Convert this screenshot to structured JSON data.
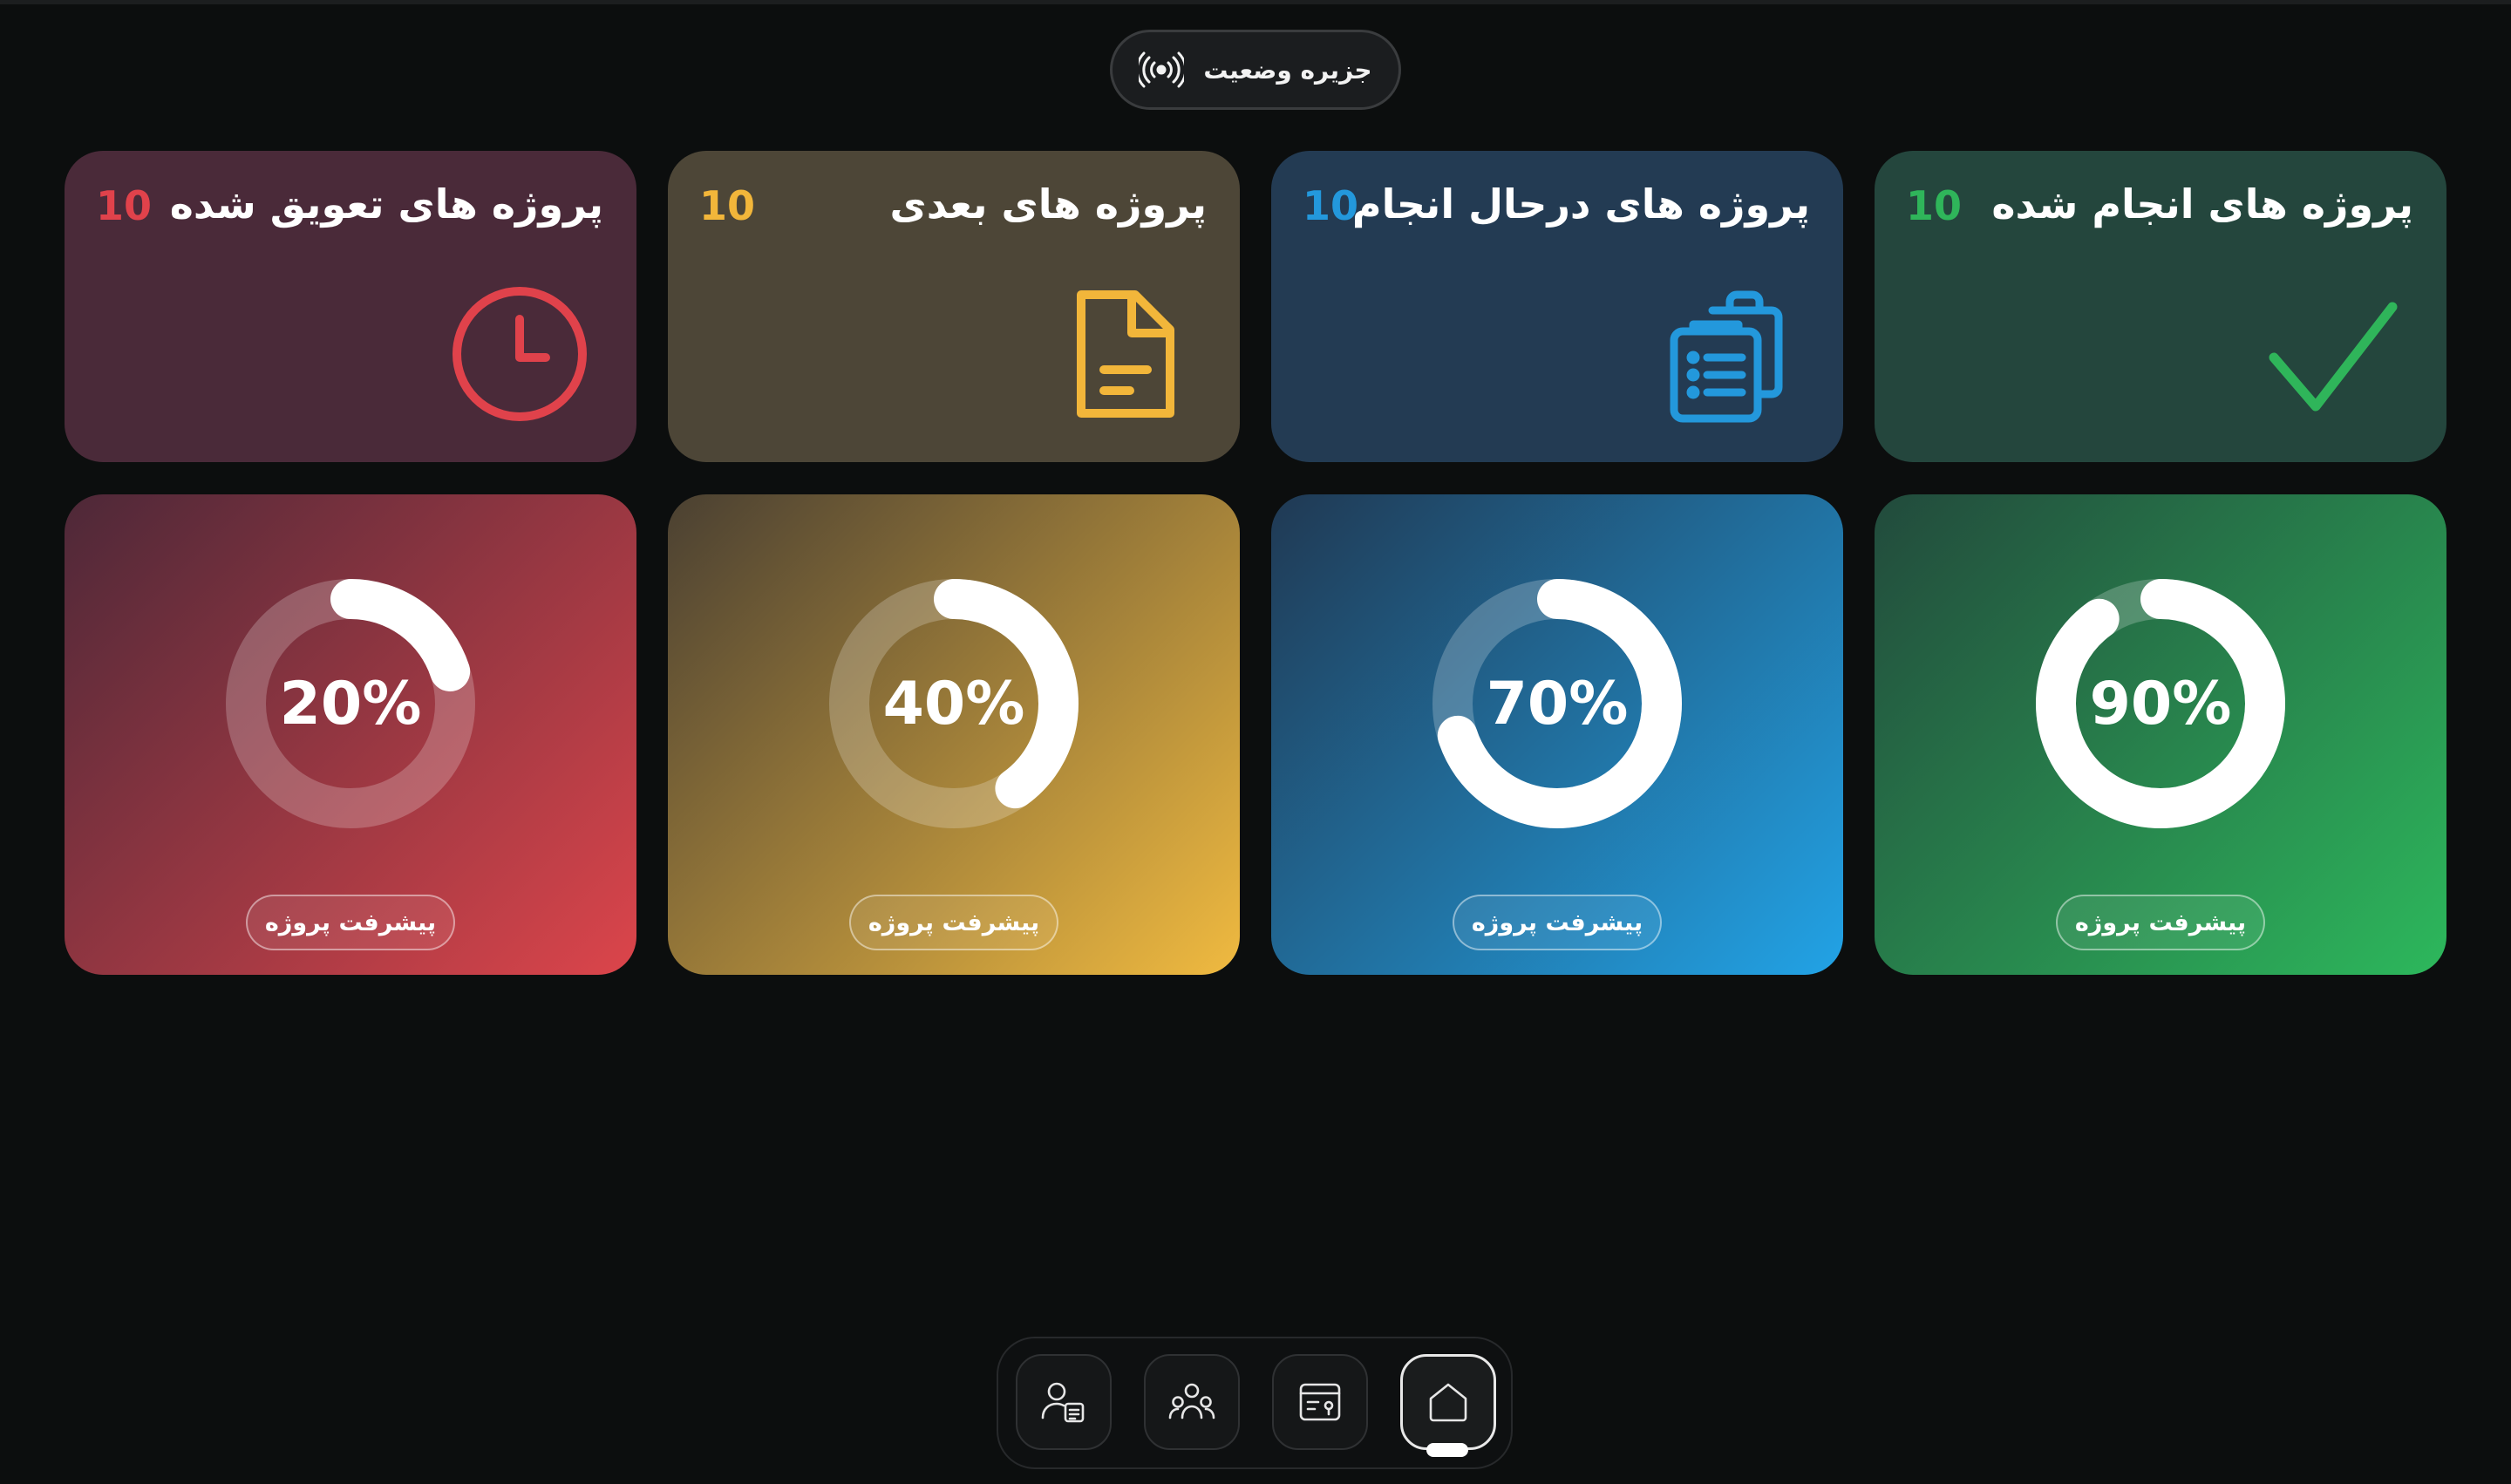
{
  "status_island": {
    "label": "جزیره وضعیت",
    "icon": "broadcast-icon"
  },
  "summary_cards": [
    {
      "title": "پروژه های تعویق شده",
      "count": "10",
      "accent": "#e0424b",
      "bg": "#4a2a39",
      "icon": "clock-icon"
    },
    {
      "title": "پروژه های بعدی",
      "count": "10",
      "accent": "#f2b63a",
      "bg": "#4d4637",
      "icon": "document-icon"
    },
    {
      "title": "پروژه های درحال انجام",
      "count": "10",
      "accent": "#2398dc",
      "bg": "#233b53",
      "icon": "clipboard-list-icon"
    },
    {
      "title": "پروژه های انجام شده",
      "count": "10",
      "accent": "#2fb55a",
      "bg": "#24463d",
      "icon": "checkmark-icon"
    }
  ],
  "progress_cards": [
    {
      "percent": 20,
      "percent_label": "20%",
      "chip_label": "پیشرفت پروژه",
      "gradient": [
        "#4d2838",
        "#dc454b"
      ]
    },
    {
      "percent": 40,
      "percent_label": "40%",
      "chip_label": "پیشرفت پروژه",
      "gradient": [
        "#4a4032",
        "#f0ba40"
      ]
    },
    {
      "percent": 70,
      "percent_label": "70%",
      "chip_label": "پیشرفت پروژه",
      "gradient": [
        "#203953",
        "#22a3e6"
      ]
    },
    {
      "percent": 90,
      "percent_label": "90%",
      "chip_label": "پیشرفت پروژه",
      "gradient": [
        "#224a3c",
        "#2db85c"
      ]
    }
  ],
  "dock": {
    "items": [
      {
        "icon": "user-report-icon",
        "active": false
      },
      {
        "icon": "team-icon",
        "active": false
      },
      {
        "icon": "board-icon",
        "active": false
      },
      {
        "icon": "home-icon",
        "active": true
      }
    ]
  }
}
